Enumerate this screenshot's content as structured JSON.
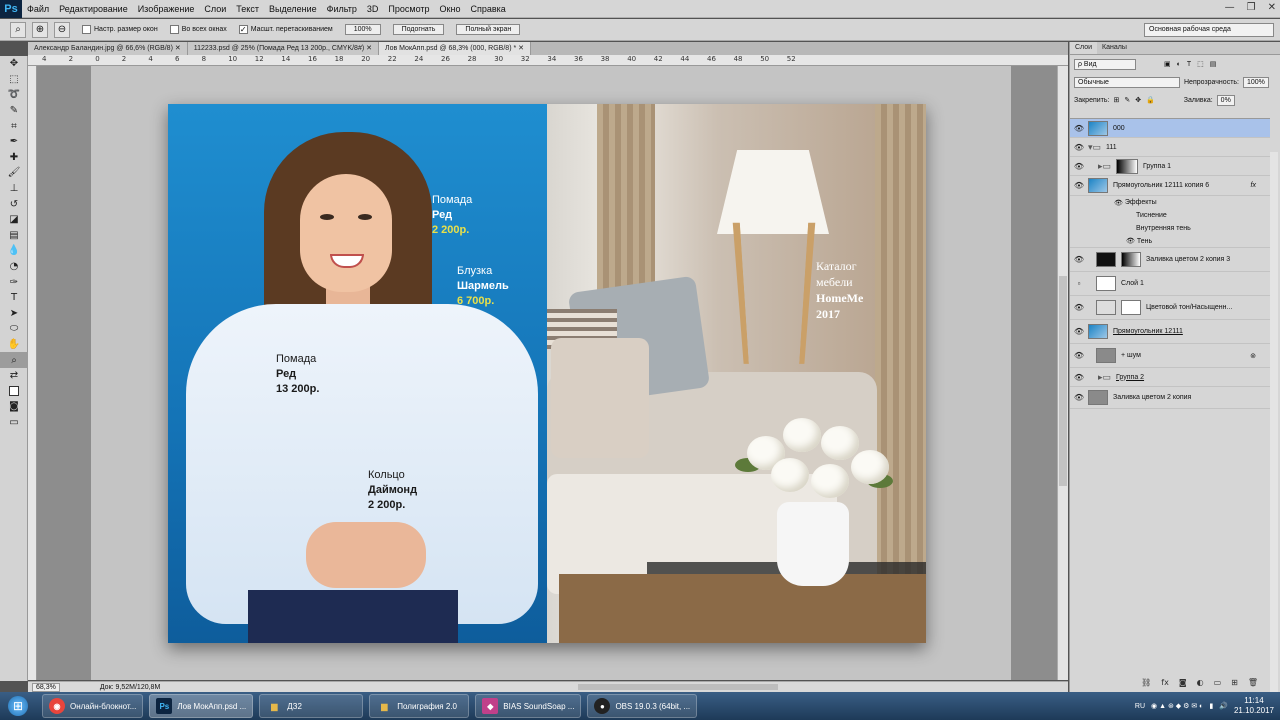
{
  "app": {
    "logo": "Ps",
    "window_controls": [
      "—",
      "❐",
      "✕"
    ]
  },
  "menu": [
    "Файл",
    "Редактирование",
    "Изображение",
    "Слои",
    "Текст",
    "Выделение",
    "Фильтр",
    "3D",
    "Просмотр",
    "Окно",
    "Справка"
  ],
  "options": {
    "resize_windows": "Настр. размер окон",
    "all_windows": "Во всех окнах",
    "scrubby_zoom": "Масшт. перетаскиванием",
    "zoom_100": "100%",
    "fit_screen": "Подогнать",
    "fill_screen": "Полный экран",
    "workspace": "Основная рабочая среда"
  },
  "tabs": [
    {
      "label": "Александр Баландин.jpg @ 66,6% (RGB/8) ✕"
    },
    {
      "label": "112233.psd @ 25% (Помада Ред 13 200р., CMYK/8#) ✕"
    },
    {
      "label": "Лов МокАпп.psd @ 68,3% (000, RGB/8) * ✕"
    }
  ],
  "ruler": [
    "4",
    "2",
    "0",
    "2",
    "4",
    "6",
    "8",
    "10",
    "12",
    "14",
    "16",
    "18",
    "20",
    "22",
    "24",
    "26",
    "28",
    "30",
    "32",
    "34",
    "36",
    "38",
    "40",
    "42",
    "44",
    "46",
    "48",
    "50",
    "52"
  ],
  "canvas": {
    "blocks": [
      {
        "l1": "Помада",
        "l2": "Ред",
        "l3": "2 200р."
      },
      {
        "l1": "Блузка",
        "l2": "Шармель",
        "l3": "6 700р."
      },
      {
        "l1": "Помада",
        "l2": "Ред",
        "l3": "13 200р."
      },
      {
        "l1": "Кольцо",
        "l2": "Даймонд",
        "l3": "2 200р."
      }
    ],
    "catalog": {
      "l1": "Каталог",
      "l2": "мебели",
      "l3": "HomeMe",
      "l4": "2017"
    }
  },
  "status": {
    "zoom": "68,3%",
    "doc": "Док: 9,52M/120,8M"
  },
  "panel": {
    "tabs": [
      "Слои",
      "Каналы"
    ],
    "filter_label": "ρ Вид",
    "blend_mode": "Обычные",
    "opacity_label": "Непрозрачность:",
    "opacity_value": "100%",
    "lock_label": "Закрепить:",
    "fill_label": "Заливка:",
    "fill_value": "0%"
  },
  "layers": [
    {
      "name": "000"
    },
    {
      "name": "111"
    },
    {
      "name": "Группа 1"
    },
    {
      "name": "Прямоугольник 12111 копия 6",
      "fx": "fx"
    },
    {
      "name": "Заливка цветом 2 копия 3"
    },
    {
      "name": "Слой 1"
    },
    {
      "name": "Цветовой тон/Насыщенн..."
    },
    {
      "name": "Прямоугольник 12111"
    },
    {
      "name": "+ шум"
    },
    {
      "name": "Группа 2"
    },
    {
      "name": "Заливка цветом 2 копия"
    }
  ],
  "effects": {
    "title": "Эффекты",
    "items": [
      "Тиснение",
      "Внутренняя тень",
      "Тень"
    ]
  },
  "taskbar": {
    "items": [
      {
        "label": "Онлайн-блокнот...",
        "icon_text": "◉",
        "color": "#e8453c"
      },
      {
        "label": "Лов МокАпп.psd ...",
        "icon_text": "Ps",
        "color": "#0c2440"
      },
      {
        "label": "ДЗ2",
        "icon_text": "▆",
        "color": "#e6b84a"
      },
      {
        "label": "Полиграфия 2.0",
        "icon_text": "▆",
        "color": "#e6b84a"
      },
      {
        "label": "BIAS SoundSoap ...",
        "icon_text": "◆",
        "color": "#c0408a"
      },
      {
        "label": "OBS 19.0.3 (64bit, ...",
        "icon_text": "●",
        "color": "#222222"
      }
    ],
    "lang": "RU",
    "time": "11:14",
    "date": "21.10.2017"
  },
  "colors": {
    "canvas_blue": "#1f8ed0",
    "price_yellow": "#e8e04a",
    "selected_layer": "#a9c2ea"
  }
}
